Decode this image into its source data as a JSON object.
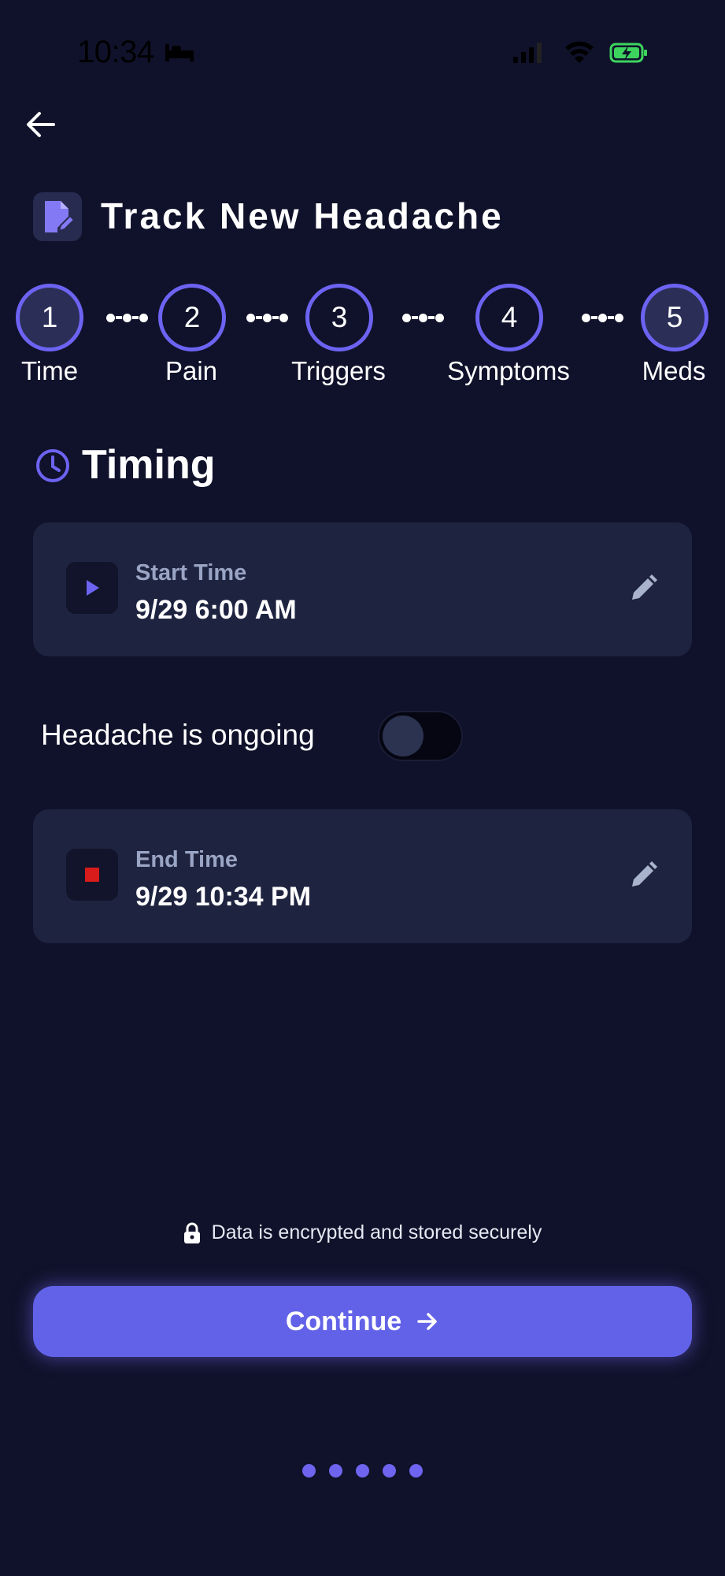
{
  "status_bar": {
    "time": "10:34"
  },
  "header": {
    "title": "Track New Headache"
  },
  "stepper": {
    "steps": [
      {
        "number": "1",
        "label": "Time"
      },
      {
        "number": "2",
        "label": "Pain"
      },
      {
        "number": "3",
        "label": "Triggers"
      },
      {
        "number": "4",
        "label": "Symptoms"
      },
      {
        "number": "5",
        "label": "Meds"
      }
    ]
  },
  "section": {
    "title": "Timing"
  },
  "start_time": {
    "label": "Start Time",
    "value": "9/29 6:00 AM"
  },
  "ongoing": {
    "label": "Headache is ongoing",
    "on": false
  },
  "end_time": {
    "label": "End Time",
    "value": "9/29 10:34 PM"
  },
  "footer": {
    "secure_text": "Data is encrypted and stored securely",
    "continue_label": "Continue"
  },
  "colors": {
    "background": "#10122b",
    "accent": "#6262e8",
    "card": "#1e2440",
    "stop_red": "#d81b1b",
    "battery_green": "#3dd45e"
  }
}
